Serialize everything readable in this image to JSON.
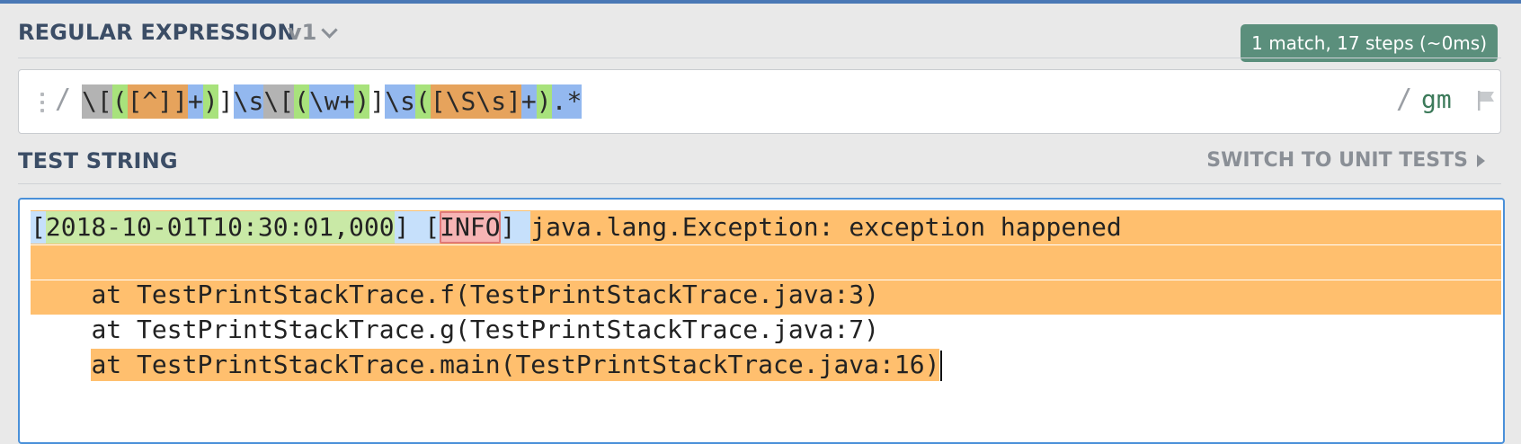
{
  "regex_section": {
    "title": "REGULAR EXPRESSION",
    "version": "v1",
    "match_info": "1 match, 17 steps (~0ms)",
    "open_delimiter": "/",
    "close_delimiter": "/",
    "flags": "gm",
    "tokens": [
      {
        "text": "\\[",
        "class": "t-gray"
      },
      {
        "text": "(",
        "class": "t-green"
      },
      {
        "text": "[^]]",
        "class": "t-orange"
      },
      {
        "text": "+",
        "class": "t-blue"
      },
      {
        "text": ")",
        "class": "t-green"
      },
      {
        "text": "]",
        "class": "t-plain"
      },
      {
        "text": "\\s",
        "class": "t-blue"
      },
      {
        "text": "\\[",
        "class": "t-gray"
      },
      {
        "text": "(",
        "class": "t-green"
      },
      {
        "text": "\\w+",
        "class": "t-blue"
      },
      {
        "text": ")",
        "class": "t-green"
      },
      {
        "text": "]",
        "class": "t-plain"
      },
      {
        "text": "\\s",
        "class": "t-blue"
      },
      {
        "text": "(",
        "class": "t-green"
      },
      {
        "text": "[\\S\\s]",
        "class": "t-orange"
      },
      {
        "text": "+",
        "class": "t-blue"
      },
      {
        "text": ")",
        "class": "t-green"
      },
      {
        "text": ".*",
        "class": "t-blue"
      }
    ]
  },
  "test_section": {
    "title": "TEST STRING",
    "switch_label": "SWITCH TO UNIT TESTS",
    "line1_parts": [
      {
        "text": "[",
        "class": "m-blue"
      },
      {
        "text": "2018-10-01T10:30:01,000",
        "class": "m-green"
      },
      {
        "text": "] [",
        "class": "m-blue"
      },
      {
        "text": "INFO",
        "class": "m-red"
      },
      {
        "text": "] ",
        "class": "m-blue"
      },
      {
        "text": "java.lang.Exception: exception happened",
        "class": "m-orange"
      }
    ],
    "lines": [
      "at TestPrintStackTrace.f(TestPrintStackTrace.java:3)",
      "at TestPrintStackTrace.g(TestPrintStackTrace.java:7)",
      "at TestPrintStackTrace.main(TestPrintStackTrace.java:16)"
    ]
  },
  "colors": {
    "accent": "#4a90d9",
    "badge": "#5b8f7c",
    "match": "#ffbf6e"
  }
}
